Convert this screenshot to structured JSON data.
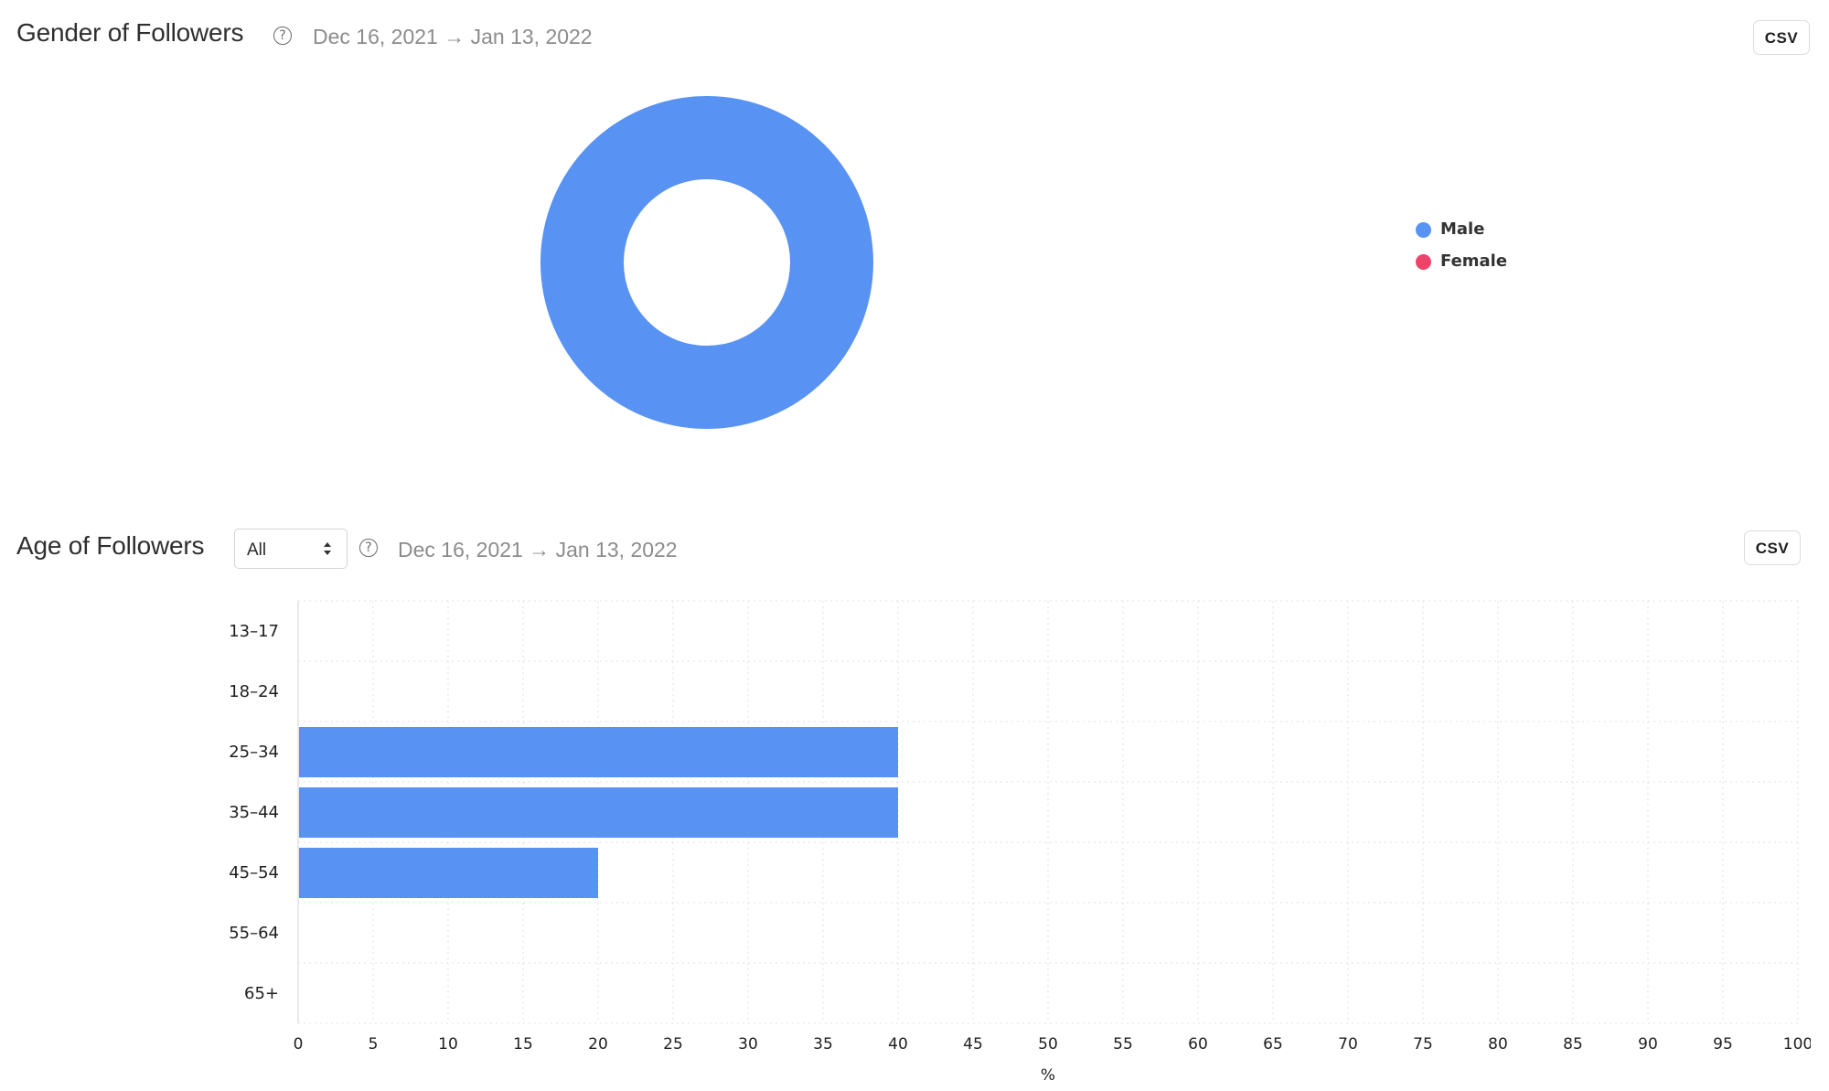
{
  "gender_section": {
    "title": "Gender of Followers",
    "help_icon": "question-circle-icon",
    "date_range": "Dec 16, 2021 → Jan 13, 2022",
    "csv_label": "CSV"
  },
  "age_section": {
    "title": "Age of Followers",
    "filter_select": {
      "selected": "All",
      "icon": "updown-chevron-icon"
    },
    "help_icon": "question-circle-icon",
    "date_range": "Dec 16, 2021 → Jan 13, 2022",
    "csv_label": "CSV"
  },
  "colors": {
    "male": "#5892f2",
    "female": "#ef4469",
    "bar": "#5892f2",
    "grid": "#e2e2e2"
  },
  "chart_data": [
    {
      "type": "pie",
      "title": "Gender of Followers",
      "donut": true,
      "labels": [
        "Male",
        "Female"
      ],
      "values": [
        100,
        0
      ],
      "colors": [
        "#5892f2",
        "#ef4469"
      ],
      "legend": {
        "placement": "right",
        "entries": [
          "Male",
          "Female"
        ]
      }
    },
    {
      "type": "bar",
      "orientation": "horizontal",
      "title": "Age of Followers",
      "categories": [
        "13-17",
        "18-24",
        "25-34",
        "35-44",
        "45-54",
        "55-64",
        "65+"
      ],
      "values": [
        0,
        0,
        40,
        40,
        20,
        0,
        0
      ],
      "xlabel": "%",
      "ylabel": "",
      "xlim": [
        0,
        100
      ],
      "xticks": [
        0,
        5,
        10,
        15,
        20,
        25,
        30,
        35,
        40,
        45,
        50,
        55,
        60,
        65,
        70,
        75,
        80,
        85,
        90,
        95,
        100
      ],
      "xtick_labels": [
        "0",
        "5",
        "10",
        "15",
        "20",
        "25",
        "30",
        "35",
        "40",
        "45",
        "50",
        "55",
        "60",
        "65",
        "70",
        "75",
        "80",
        "85",
        "90",
        "95",
        "100"
      ],
      "grid": true,
      "color": "#5892f2"
    }
  ]
}
